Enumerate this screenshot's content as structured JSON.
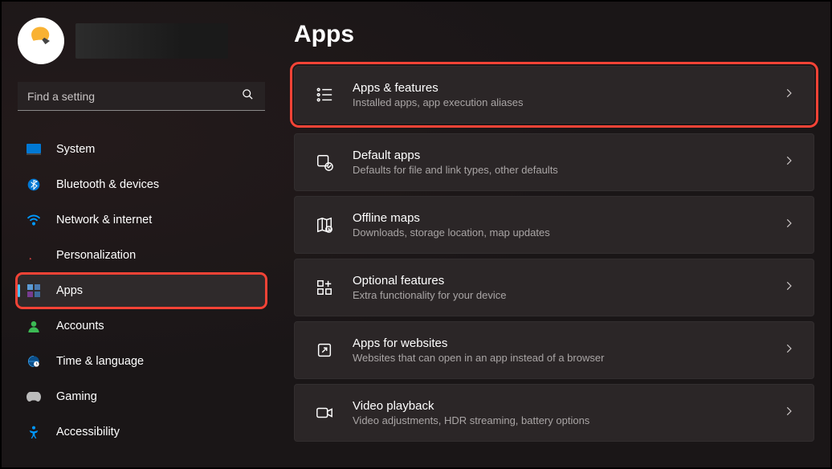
{
  "search": {
    "placeholder": "Find a setting"
  },
  "page": {
    "title": "Apps"
  },
  "nav": {
    "system": {
      "label": "System"
    },
    "bluetooth": {
      "label": "Bluetooth & devices"
    },
    "network": {
      "label": "Network & internet"
    },
    "personalize": {
      "label": "Personalization"
    },
    "apps": {
      "label": "Apps"
    },
    "accounts": {
      "label": "Accounts"
    },
    "time": {
      "label": "Time & language"
    },
    "gaming": {
      "label": "Gaming"
    },
    "accessibility": {
      "label": "Accessibility"
    }
  },
  "cards": {
    "apps_features": {
      "title": "Apps & features",
      "subtitle": "Installed apps, app execution aliases"
    },
    "default_apps": {
      "title": "Default apps",
      "subtitle": "Defaults for file and link types, other defaults"
    },
    "offline_maps": {
      "title": "Offline maps",
      "subtitle": "Downloads, storage location, map updates"
    },
    "optional_features": {
      "title": "Optional features",
      "subtitle": "Extra functionality for your device"
    },
    "apps_websites": {
      "title": "Apps for websites",
      "subtitle": "Websites that can open in an app instead of a browser"
    },
    "video_playback": {
      "title": "Video playback",
      "subtitle": "Video adjustments, HDR streaming, battery options"
    }
  }
}
